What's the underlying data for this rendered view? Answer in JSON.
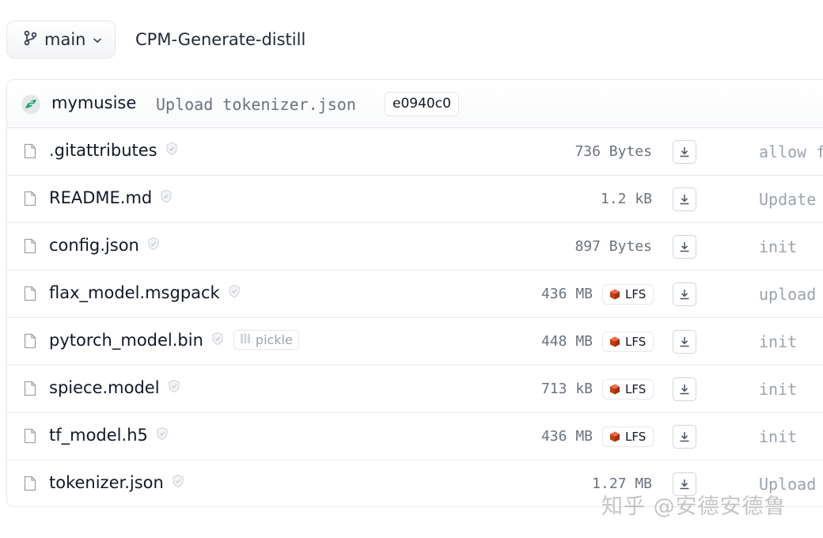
{
  "header": {
    "branch_label": "main",
    "repo_name": "CPM-Generate-distill"
  },
  "commit": {
    "author": "mymusise",
    "message": "Upload tokenizer.json",
    "hash": "e0940c0"
  },
  "files": [
    {
      "name": ".gitattributes",
      "size": "736 Bytes",
      "lfs": false,
      "pickle": false,
      "last_commit": "allow f"
    },
    {
      "name": "README.md",
      "size": "1.2 kB",
      "lfs": false,
      "pickle": false,
      "last_commit": "Update"
    },
    {
      "name": "config.json",
      "size": "897 Bytes",
      "lfs": false,
      "pickle": false,
      "last_commit": "init"
    },
    {
      "name": "flax_model.msgpack",
      "size": "436 MB",
      "lfs": true,
      "pickle": false,
      "last_commit": "upload"
    },
    {
      "name": "pytorch_model.bin",
      "size": "448 MB",
      "lfs": true,
      "pickle": true,
      "last_commit": "init"
    },
    {
      "name": "spiece.model",
      "size": "713 kB",
      "lfs": true,
      "pickle": false,
      "last_commit": "init"
    },
    {
      "name": "tf_model.h5",
      "size": "436 MB",
      "lfs": true,
      "pickle": false,
      "last_commit": "init"
    },
    {
      "name": "tokenizer.json",
      "size": "1.27 MB",
      "lfs": false,
      "pickle": false,
      "last_commit": "Upload"
    }
  ],
  "badges": {
    "lfs_label": "LFS",
    "pickle_label": "pickle"
  },
  "icons": {
    "branch": "git-branch-icon",
    "chevron": "chevron-down-icon",
    "file": "file-icon",
    "safe": "shield-check-icon",
    "download": "download-icon",
    "lfs": "lfs-cube-icon",
    "pickle": "pickle-icon"
  },
  "watermark": "知乎 @安德安德鲁",
  "colors": {
    "lfs_cube": "#c2410c",
    "border": "#e5e7eb",
    "muted_text": "#6b7280"
  }
}
